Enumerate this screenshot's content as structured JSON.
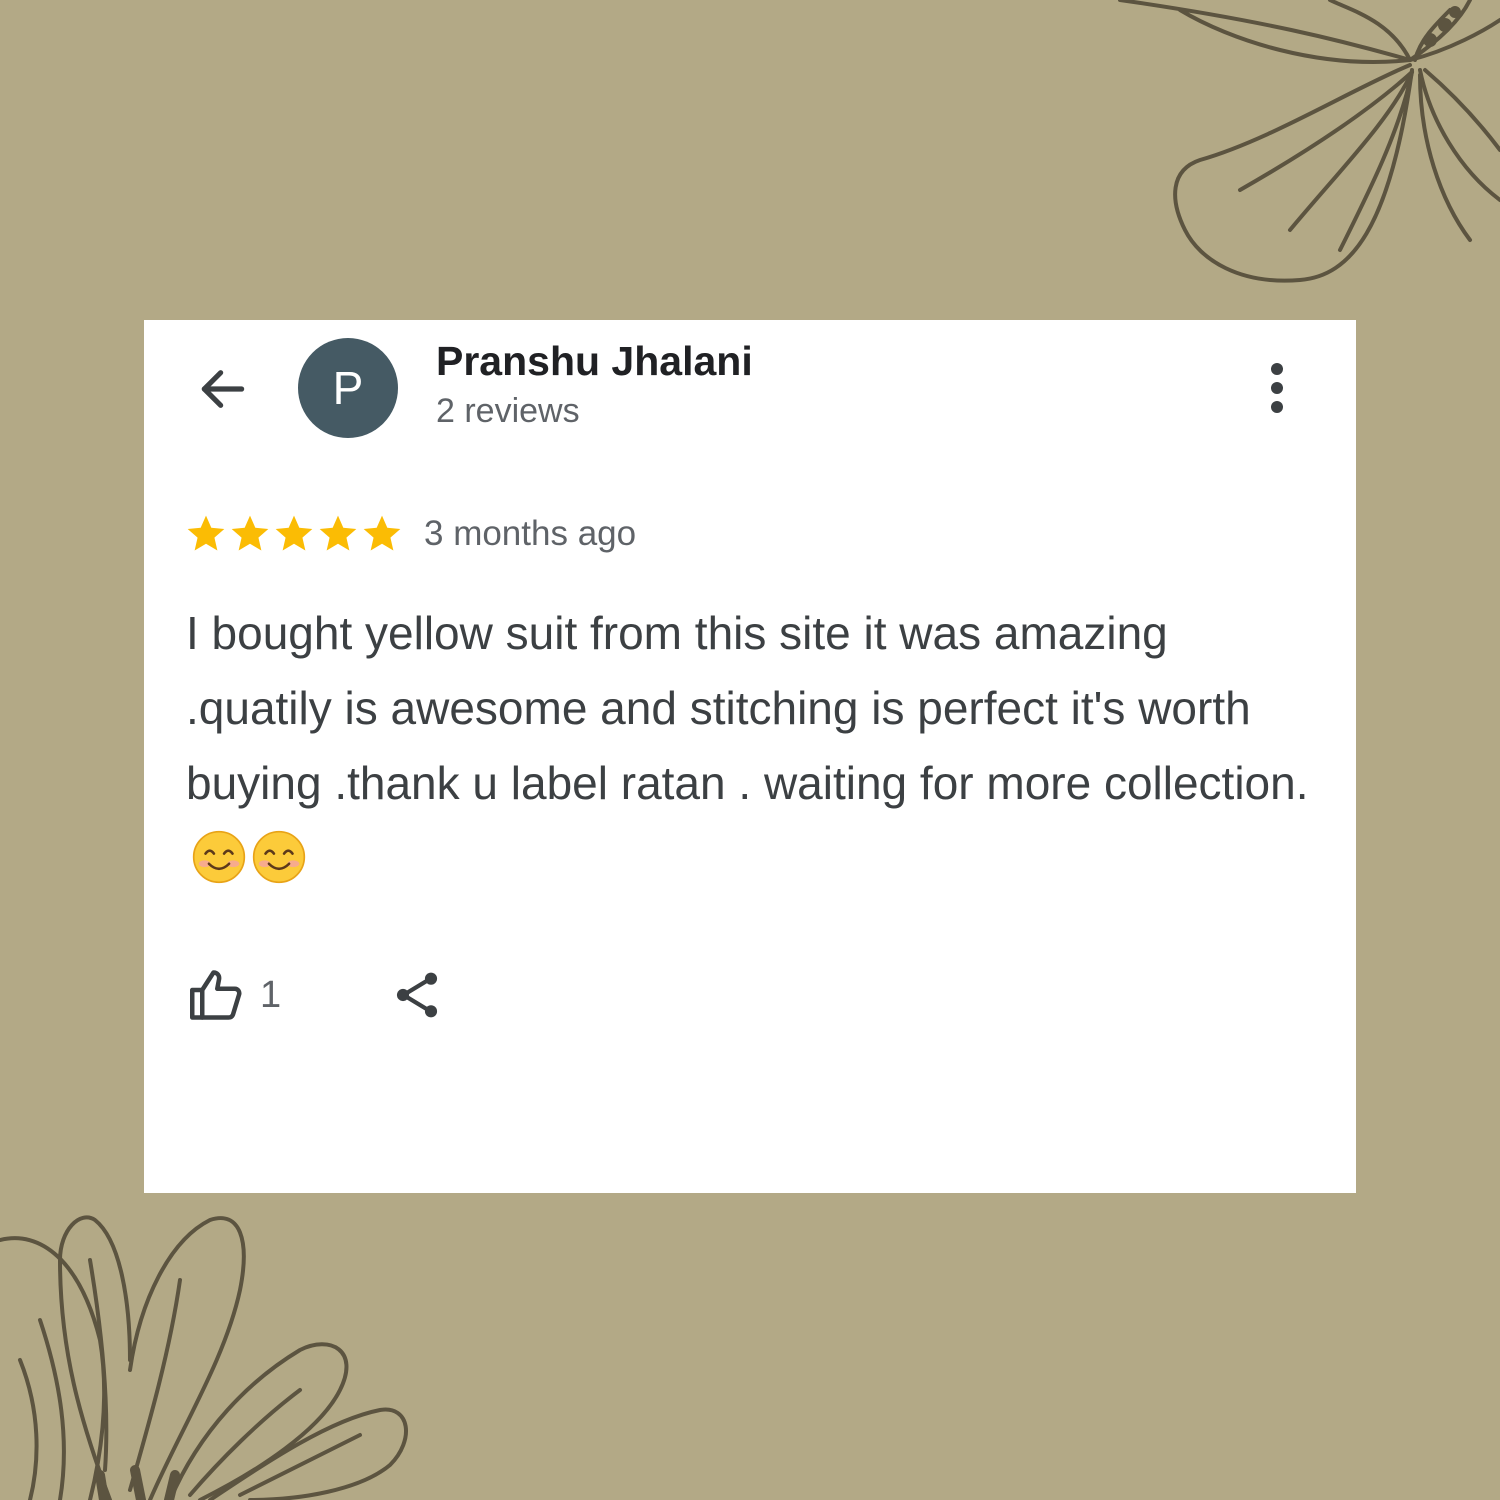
{
  "colors": {
    "background": "#b3a986",
    "card": "#ffffff",
    "avatar": "#455a64",
    "star": "#fbbc04",
    "flower_stroke": "#5c5440",
    "icon": "#3c4043"
  },
  "header": {
    "back_icon": "arrow-left-icon",
    "avatar_initial": "P",
    "reviewer_name": "Pranshu Jhalani",
    "reviewer_meta": "2 reviews",
    "more_icon": "more-vertical-icon"
  },
  "review": {
    "rating": 5,
    "rating_max": 5,
    "timestamp": "3 months ago",
    "text": "I bought yellow suit from this site it was amazing .quatily is awesome and stitching is perfect it's worth buying .thank u label ratan . waiting for more collection.",
    "emojis": [
      "smiling-face-icon",
      "smiling-face-icon"
    ]
  },
  "actions": {
    "like_icon": "thumbs-up-icon",
    "like_count": "1",
    "share_icon": "share-icon"
  }
}
